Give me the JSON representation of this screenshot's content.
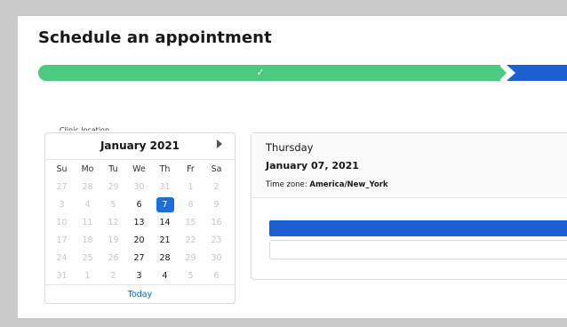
{
  "page": {
    "title": "Schedule an appointment"
  },
  "path": {
    "colors": {
      "complete": "#4bca81",
      "current": "#1b5fd0"
    },
    "check_icon": "checkmark-icon"
  },
  "clinic_location_label": "Clinic location",
  "calendar": {
    "month_label": "January 2021",
    "next_icon": "triangle-right-icon",
    "weekdays": [
      "Su",
      "Mo",
      "Tu",
      "We",
      "Th",
      "Fr",
      "Sa"
    ],
    "weeks": [
      [
        "27",
        "28",
        "29",
        "30",
        "31",
        "1",
        "2"
      ],
      [
        "3",
        "4",
        "5",
        "6",
        "7",
        "8",
        "9"
      ],
      [
        "10",
        "11",
        "12",
        "13",
        "14",
        "15",
        "16"
      ],
      [
        "17",
        "18",
        "19",
        "20",
        "21",
        "22",
        "23"
      ],
      [
        "24",
        "25",
        "26",
        "27",
        "28",
        "29",
        "30"
      ],
      [
        "31",
        "1",
        "2",
        "3",
        "4",
        "5",
        "6"
      ]
    ],
    "selected_day": "7",
    "today_label": "Today"
  },
  "day": {
    "weekday": "Thursday",
    "date": "January 07, 2021",
    "timezone_label": "Time zone:",
    "timezone_value": "America/New_York"
  }
}
